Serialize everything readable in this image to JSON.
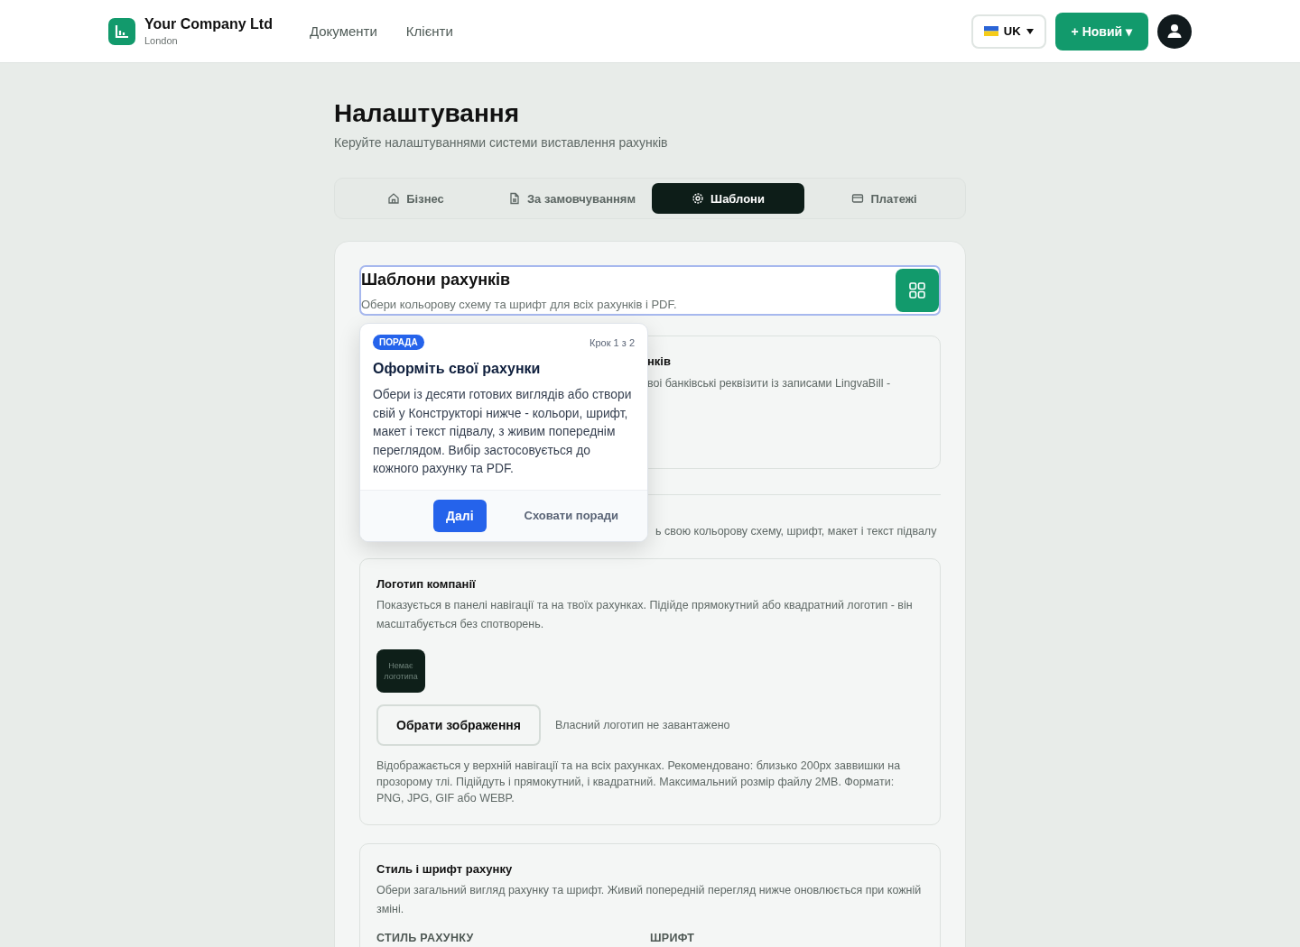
{
  "header": {
    "company": "Your Company Ltd",
    "city": "London",
    "nav": [
      {
        "label": "Документи"
      },
      {
        "label": "Клієнти"
      }
    ],
    "language": "UK",
    "new_button": "+ Новий ▾"
  },
  "page": {
    "title": "Налаштування",
    "subtitle": "Керуйте налаштуваннями системи виставлення рахунків"
  },
  "tabs": [
    {
      "label": "Бізнес",
      "selected": false
    },
    {
      "label": "За замовчуванням",
      "selected": false
    },
    {
      "label": "Шаблони",
      "selected": true
    },
    {
      "label": "Платежі",
      "selected": false
    }
  ],
  "section": {
    "title": "Шаблони рахунків",
    "subtitle": "Обери кольорову схему та шрифт для всіх рахунків і PDF."
  },
  "covered": {
    "card_title": "нків",
    "card_text": "воі банківські реквізити із записами LingvaBill -",
    "row_text": "ь свою кольорову схему, шрифт, макет і текст підвалу"
  },
  "tip": {
    "badge": "ПОРАДА",
    "step": "Крок 1 з 2",
    "title": "Оформіть свої рахунки",
    "text": "Обери із десяти готових виглядів або створи свій у Конструкторі нижче - кольори, шрифт, макет і текст підвалу, з живим попереднім переглядом. Вибір застосовується до кожного рахунку та PDF.",
    "next": "Далі",
    "hide": "Сховати поради"
  },
  "logo_card": {
    "title": "Логотип компанії",
    "text": "Показується в панелі навігації та на твоїх рахунках. Підійде прямокутний або квадратний логотип - він масштабується без спотворень.",
    "placeholder": "Немає логотипа",
    "choose": "Обрати зображення",
    "status": "Власний логотип не завантажено",
    "hint": "Відображається у верхній навігації та на всіх рахунках. Рекомендовано: близько 200px заввишки на прозорому тлі. Підійдуть і прямокутний, і квадратний. Максимальний розмір файлу 2MB. Формати: PNG, JPG, GIF або WEBP."
  },
  "style_card": {
    "title": "Стиль і шрифт рахунку",
    "text": "Обери загальний вигляд рахунку та шрифт. Живий попередній перегляд нижче оновлюється при кожній зміні.",
    "labels": [
      "СТИЛЬ РАХУНКУ",
      "ШРИФТ"
    ]
  }
}
